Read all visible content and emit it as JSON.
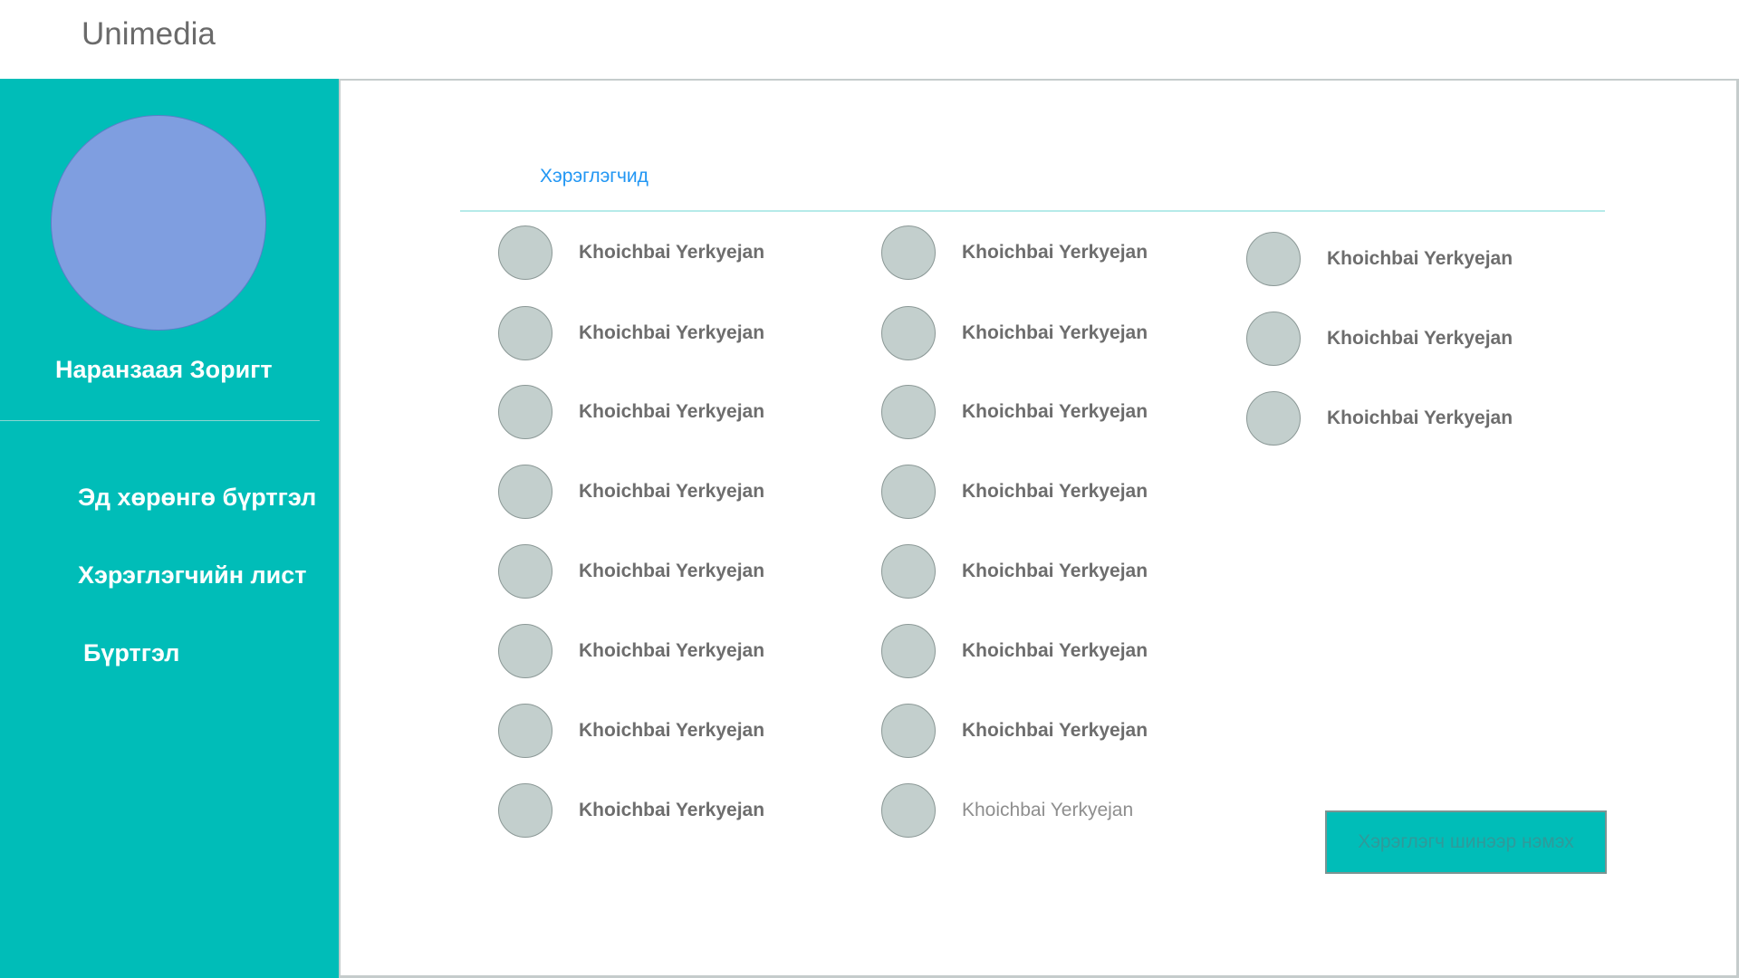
{
  "app": {
    "title": "Unimedia"
  },
  "sidebar": {
    "user_name": "Наранзаая Зоригт",
    "items": [
      {
        "label": "Эд хөрөнгө бүртгэл"
      },
      {
        "label": "Хэрэглэгчийн лист"
      },
      {
        "label": "Бүртгэл"
      }
    ]
  },
  "main": {
    "section_title": "Хэрэглэгчид",
    "users": {
      "col1": [
        "Khoichbai Yerkyejan",
        "Khoichbai Yerkyejan",
        "Khoichbai Yerkyejan",
        "Khoichbai Yerkyejan",
        "Khoichbai Yerkyejan",
        "Khoichbai Yerkyejan",
        "Khoichbai Yerkyejan",
        "Khoichbai Yerkyejan"
      ],
      "col2": [
        "Khoichbai Yerkyejan",
        "Khoichbai Yerkyejan",
        "Khoichbai Yerkyejan",
        "Khoichbai Yerkyejan",
        "Khoichbai Yerkyejan",
        "Khoichbai Yerkyejan",
        "Khoichbai Yerkyejan",
        "Khoichbai Yerkyejan"
      ],
      "col3": [
        "Khoichbai Yerkyejan",
        "Khoichbai Yerkyejan",
        "Khoichbai Yerkyejan"
      ]
    },
    "add_button_label": "Хэрэглэгч шинээр нэмэх"
  },
  "colors": {
    "sidebar_bg": "#00bdb8",
    "avatar_main": "#7f9ee0",
    "user_avatar": "#c3cfcd",
    "link_blue": "#2196f3"
  }
}
